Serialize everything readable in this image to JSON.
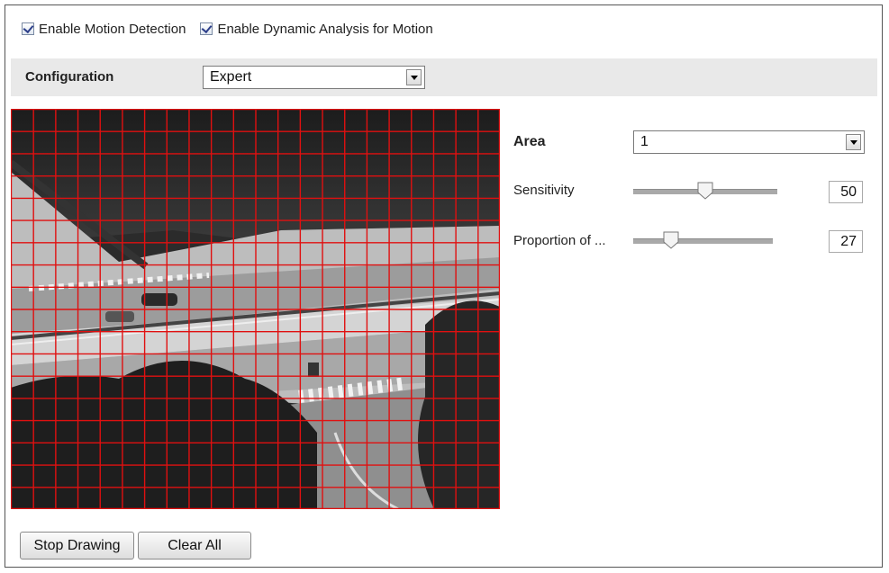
{
  "options": {
    "motion_detection": {
      "label": "Enable Motion Detection",
      "checked": true
    },
    "dynamic_analysis": {
      "label": "Enable Dynamic Analysis for Motion",
      "checked": true
    }
  },
  "configuration": {
    "label": "Configuration",
    "selected": "Expert"
  },
  "area": {
    "label": "Area",
    "selected": "1"
  },
  "sensitivity": {
    "label": "Sensitivity",
    "value": "50",
    "level": 50
  },
  "proportion": {
    "label": "Proportion of ...",
    "value": "27",
    "level": 27
  },
  "buttons": {
    "stop_drawing": "Stop Drawing",
    "clear_all": "Clear All"
  },
  "colors": {
    "grid_line": "#e01010",
    "bar_bg": "#e9e9e9",
    "check": "#2d3f8a"
  },
  "grid": {
    "columns": 22,
    "rows": 18
  }
}
